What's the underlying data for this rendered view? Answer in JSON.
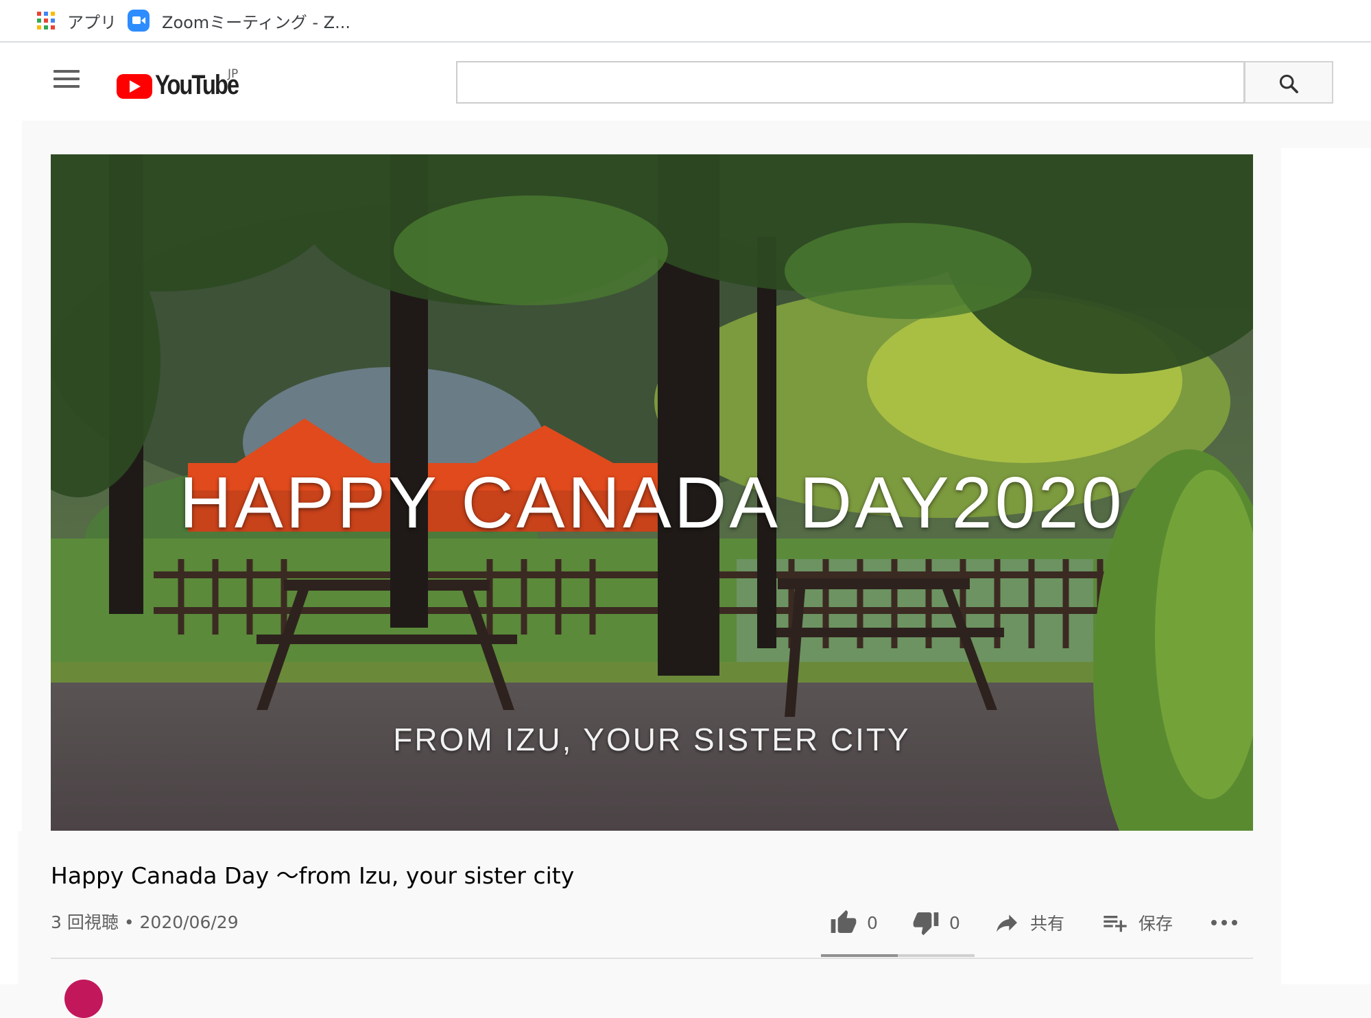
{
  "bookmarks": {
    "apps_label": "アプリ",
    "zoom_label": "Zoomミーティング - Z..."
  },
  "header": {
    "logo_text": "YouTube",
    "country_code": "JP",
    "search_placeholder": ""
  },
  "video": {
    "overlay_title": "HAPPY CANADA DAY2020",
    "overlay_subtitle": "FROM IZU,  YOUR SISTER CITY",
    "title": "Happy Canada Day ～from Izu, your sister city",
    "views": "3 回視聴",
    "separator": "•",
    "date": "2020/06/29"
  },
  "actions": {
    "like_count": "0",
    "dislike_count": "0",
    "share_label": "共有",
    "save_label": "保存"
  },
  "like_ratio": 0.5,
  "colors": {
    "brand_red": "#ff0000",
    "zoom_blue": "#2d8cff",
    "text_primary": "#030303",
    "text_secondary": "#606060"
  },
  "icons": {
    "apps": "apps-grid-icon",
    "zoom": "zoom-camera-icon",
    "menu": "hamburger-icon",
    "search": "search-icon",
    "like": "thumbs-up-icon",
    "dislike": "thumbs-down-icon",
    "share": "share-arrow-icon",
    "save": "playlist-add-icon",
    "more": "more-horiz-icon"
  }
}
